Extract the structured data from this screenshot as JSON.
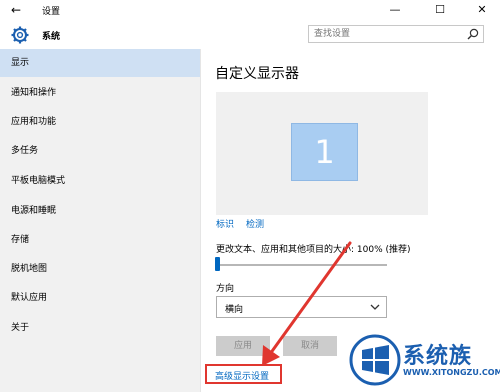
{
  "titlebar": {
    "back": "←",
    "title": "设置",
    "minimize": "—",
    "maximize": "☐",
    "close": "✕"
  },
  "header": {
    "section": "系统",
    "search_placeholder": "查找设置"
  },
  "sidebar": {
    "items": [
      {
        "label": "显示",
        "active": true
      },
      {
        "label": "通知和操作"
      },
      {
        "label": "应用和功能"
      },
      {
        "label": "多任务"
      },
      {
        "label": "平板电脑模式"
      },
      {
        "label": "电源和睡眠"
      },
      {
        "label": "存储"
      },
      {
        "label": "脱机地图"
      },
      {
        "label": "默认应用"
      },
      {
        "label": "关于"
      }
    ]
  },
  "main": {
    "title": "自定义显示器",
    "monitor_number": "1",
    "identify_link": "标识",
    "detect_link": "检测",
    "scale_label": "更改文本、应用和其他项目的大小: 100% (推荐)",
    "scale_value_percent": 100,
    "orientation_label": "方向",
    "orientation_value": "横向",
    "apply_button": "应用",
    "cancel_button": "取消",
    "advanced_link": "高级显示设置"
  },
  "watermark": {
    "text": "系统族",
    "url": "WWW.XITONGZU.COM"
  },
  "colors": {
    "accent": "#0067c0",
    "nav_active": "#cfe0f3",
    "annotation": "#e0362f",
    "monitor": "#a9cdf2"
  }
}
